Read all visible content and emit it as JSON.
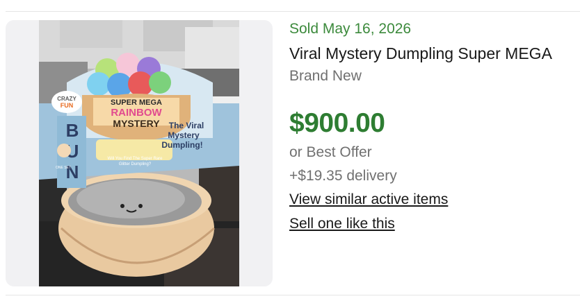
{
  "listing": {
    "sold_date": "Sold May 16, 2026",
    "title": "Viral Mystery Dumpling Super MEGA",
    "condition": "Brand New",
    "price": "$900.00",
    "offer_text": "or Best Offer",
    "delivery": "+$19.35 delivery",
    "links": {
      "similar": "View similar active items",
      "sell": "Sell one like this"
    }
  },
  "photo_box": {
    "brand": "CRAZY FUN",
    "headline": [
      "SUPER MEGA",
      "RAINBOW",
      "MYSTERY"
    ],
    "bun_letters": "BUN",
    "side_text": [
      "The Viral",
      "Mystery",
      "Dumpling!"
    ],
    "question": [
      "Will You Find The Super Rare",
      "Glitter Dumpling?"
    ],
    "tag": "ONE SET"
  },
  "colors": {
    "sold_green": "#3c8a3c",
    "price_green": "#2e7d32",
    "text_dark": "#191919",
    "text_muted": "#707070"
  }
}
